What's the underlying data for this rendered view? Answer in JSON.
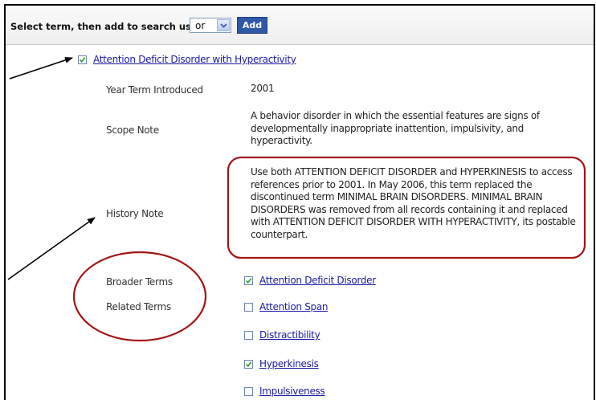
{
  "toolbar": {
    "prompt": "Select term, then add to search using:",
    "operator": "or",
    "add_label": "Add"
  },
  "main_term": {
    "label": "Attention Deficit Disorder with Hyperactivity",
    "checked": true
  },
  "fields": {
    "year_label": "Year Term Introduced",
    "year_value": "2001",
    "scope_label": "Scope Note",
    "scope_value": "A behavior disorder in which the essential features are signs of developmentally inappropriate inattention, impulsivity, and hyperactivity.",
    "history_label": "History Note",
    "history_value": "Use both ATTENTION DEFICIT DISORDER and HYPERKINESIS to access references prior to 2001. In May 2006, this term replaced the discontinued term MINIMAL BRAIN DISORDERS. MINIMAL BRAIN DISORDERS was removed from all records containing it and replaced with ATTENTION DEFICIT DISORDER WITH HYPERACTIVITY, its postable counterpart.",
    "broader_label": "Broader Terms",
    "related_label": "Related Terms"
  },
  "broader_terms": [
    {
      "label": "Attention Deficit Disorder",
      "checked": true
    }
  ],
  "related_terms": [
    {
      "label": "Attention Span",
      "checked": false
    },
    {
      "label": "Distractibility",
      "checked": false
    },
    {
      "label": "Hyperkinesis",
      "checked": true
    },
    {
      "label": "Impulsiveness",
      "checked": false
    }
  ],
  "colors": {
    "annotation": "#a31515",
    "link": "#1a1aa6",
    "button": "#2f59a7"
  }
}
